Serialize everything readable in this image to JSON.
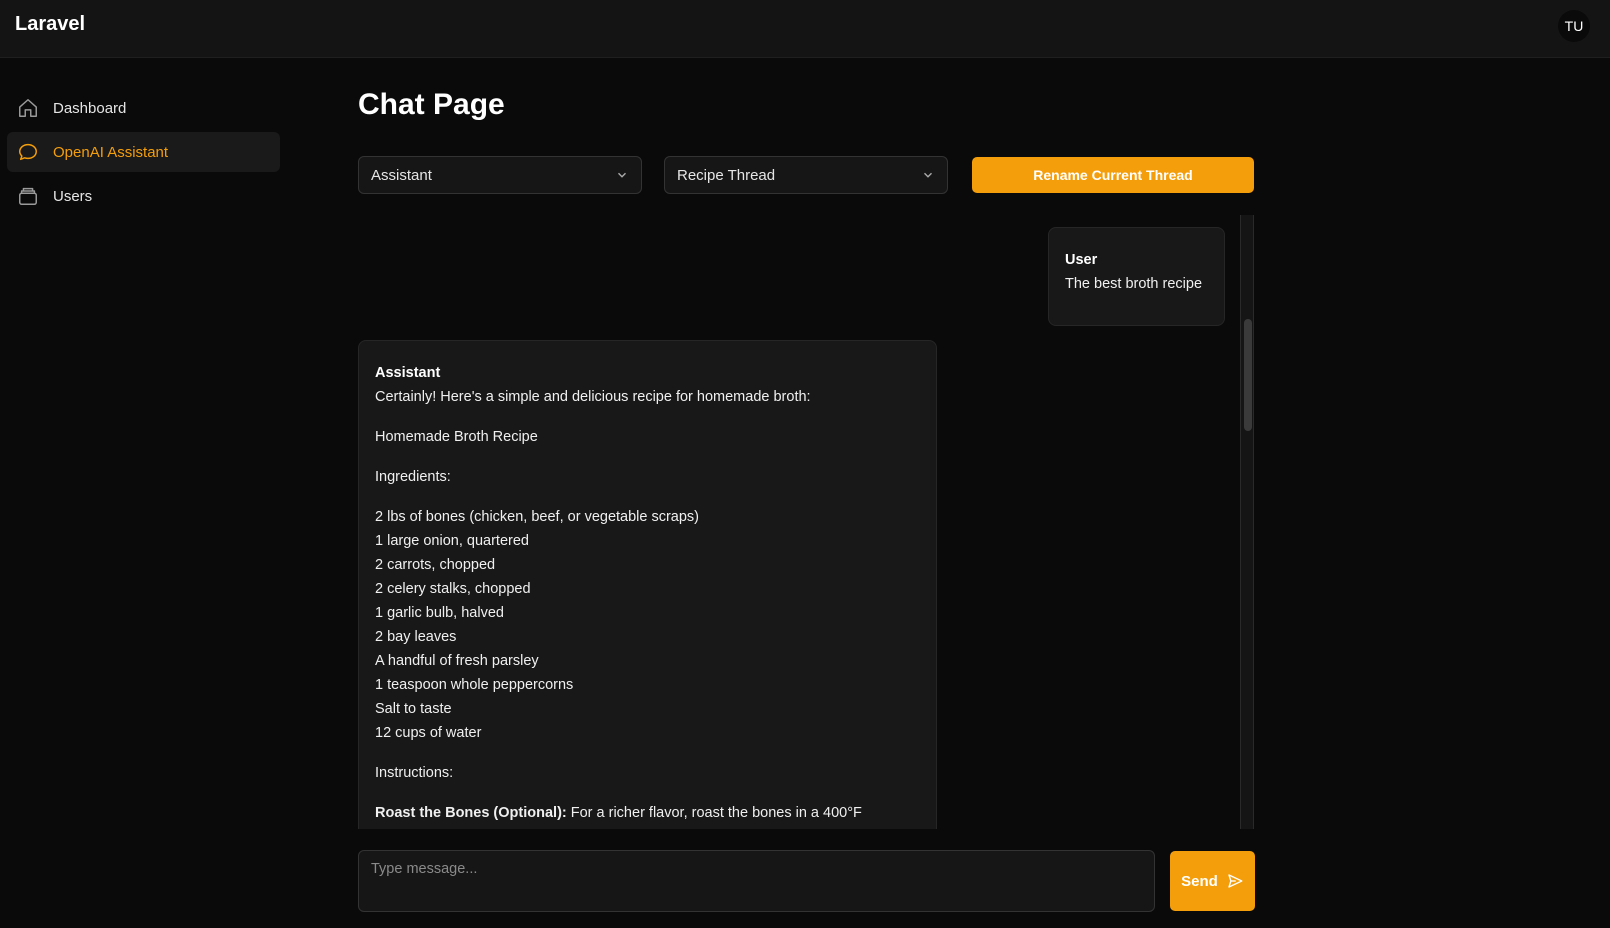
{
  "header": {
    "brand": "Laravel",
    "avatar_initials": "TU"
  },
  "sidebar": {
    "items": [
      {
        "label": "Dashboard",
        "icon": "home-icon",
        "active": false
      },
      {
        "label": "OpenAI Assistant",
        "icon": "chat-bubble-icon",
        "active": true
      },
      {
        "label": "Users",
        "icon": "archive-icon",
        "active": false
      }
    ]
  },
  "main": {
    "title": "Chat Page",
    "assistant_select": {
      "value": "Assistant"
    },
    "thread_select": {
      "value": "Recipe Thread"
    },
    "rename_button": "Rename Current Thread"
  },
  "messages": {
    "user": {
      "author": "User",
      "text": "The best broth recipe"
    },
    "assistant": {
      "author": "Assistant",
      "intro": "Certainly! Here's a simple and delicious recipe for homemade broth:",
      "heading": "Homemade Broth Recipe",
      "ingredients_label": "Ingredients:",
      "ingredients": [
        "2 lbs of bones (chicken, beef, or vegetable scraps)",
        "1 large onion, quartered",
        "2 carrots, chopped",
        "2 celery stalks, chopped",
        "1 garlic bulb, halved",
        "2 bay leaves",
        "A handful of fresh parsley",
        "1 teaspoon whole peppercorns",
        "Salt to taste",
        "12 cups of water"
      ],
      "instructions_label": "Instructions:",
      "step1_title": "Roast the Bones (Optional):",
      "step1_text": " For a richer flavor, roast the bones in a 400°F"
    }
  },
  "composer": {
    "placeholder": "Type message...",
    "send_label": "Send"
  },
  "colors": {
    "accent": "#f59e0b",
    "background": "#0a0a0a",
    "panel": "#181818"
  }
}
